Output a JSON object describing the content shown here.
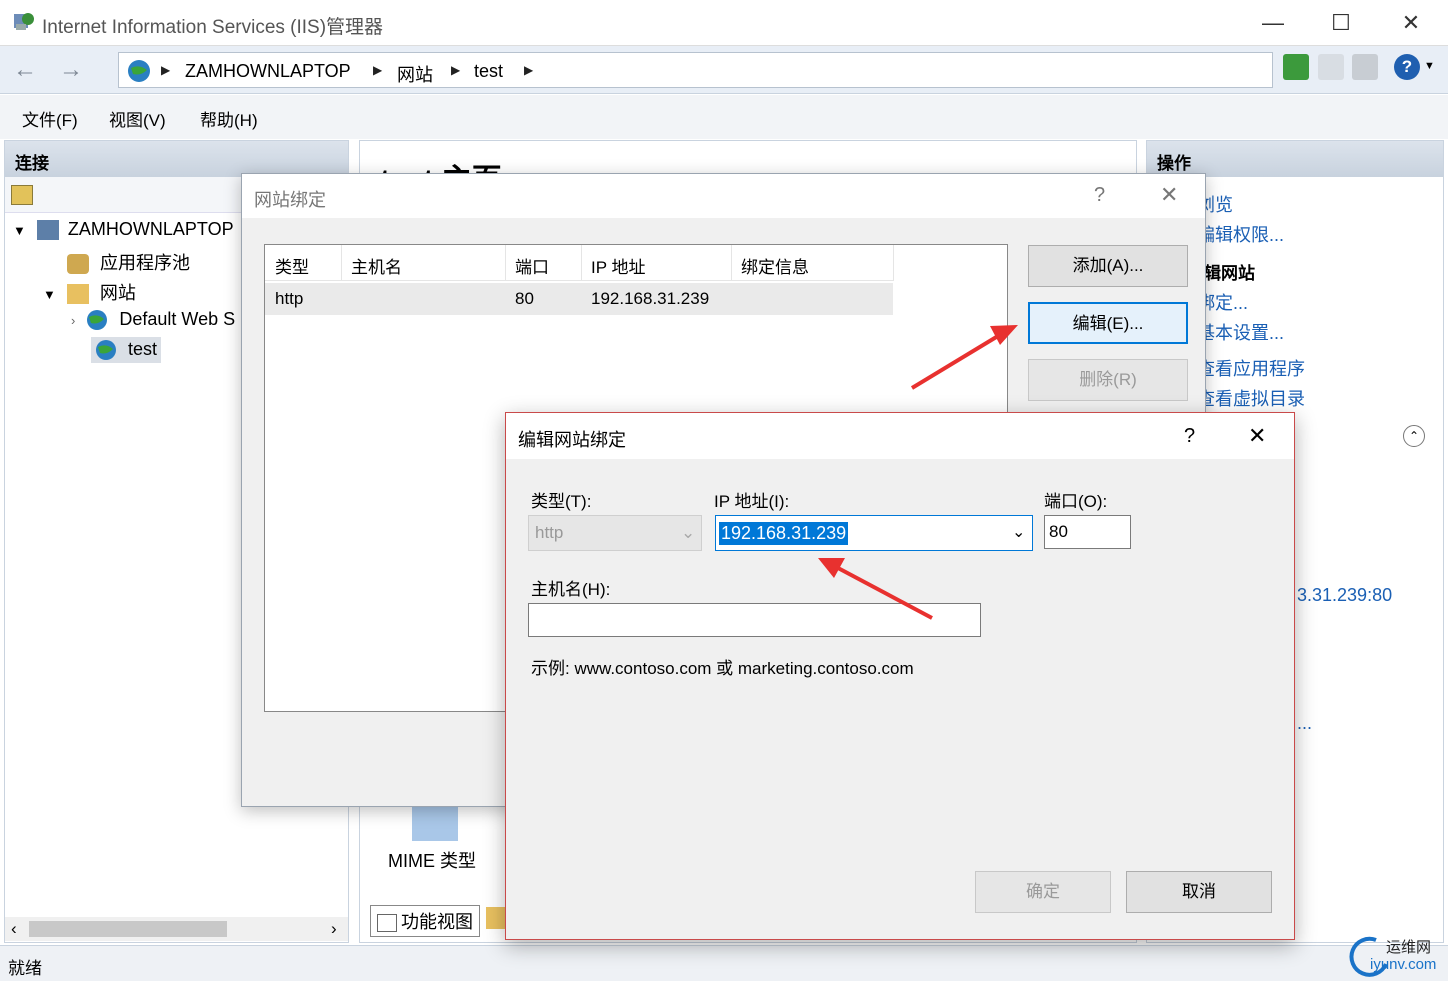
{
  "window": {
    "title": "Internet Information Services (IIS)管理器"
  },
  "address": {
    "crumbs": [
      "ZAMHOWNLAPTOP",
      "网站",
      "test"
    ]
  },
  "menu": {
    "file": "文件(F)",
    "view": "视图(V)",
    "help": "帮助(H)"
  },
  "left": {
    "header": "连接",
    "tree": {
      "server": "ZAMHOWNLAPTOP",
      "apppools": "应用程序池",
      "sites": "网站",
      "default_site": "Default Web S",
      "test_site": "test"
    }
  },
  "center": {
    "title_partial": "test 主页",
    "mime_label": "MIME 类型",
    "tab_features": "功能视图"
  },
  "right": {
    "header": "操作",
    "links": [
      "浏览",
      "编辑权限...",
      "编辑网站",
      "绑定...",
      "基本设置...",
      "查看应用程序",
      "查看虚拟目录"
    ],
    "binding_partial": "3.31.239:80",
    "more_partial": "..."
  },
  "status": {
    "text": "就绪"
  },
  "dialog_bindings": {
    "title": "网站绑定",
    "help": "?",
    "columns": [
      "类型",
      "主机名",
      "端口",
      "IP 地址",
      "绑定信息"
    ],
    "rows": [
      {
        "type": "http",
        "host": "",
        "port": "80",
        "ip": "192.168.31.239",
        "info": ""
      }
    ],
    "add": "添加(A)...",
    "edit": "编辑(E)...",
    "remove": "删除(R)"
  },
  "dialog_edit": {
    "title": "编辑网站绑定",
    "help": "?",
    "type_label": "类型(T):",
    "type_value": "http",
    "ip_label": "IP 地址(I):",
    "ip_value": "192.168.31.239",
    "port_label": "端口(O):",
    "port_value": "80",
    "host_label": "主机名(H):",
    "host_value": "",
    "example": "示例: www.contoso.com 或 marketing.contoso.com",
    "ok": "确定",
    "cancel": "取消"
  },
  "watermark": {
    "line1": "运维网",
    "line2": "iyunv.com"
  },
  "colors": {
    "link": "#1a5fb4",
    "selection": "#0078d7",
    "arrow": "#e8312f"
  }
}
